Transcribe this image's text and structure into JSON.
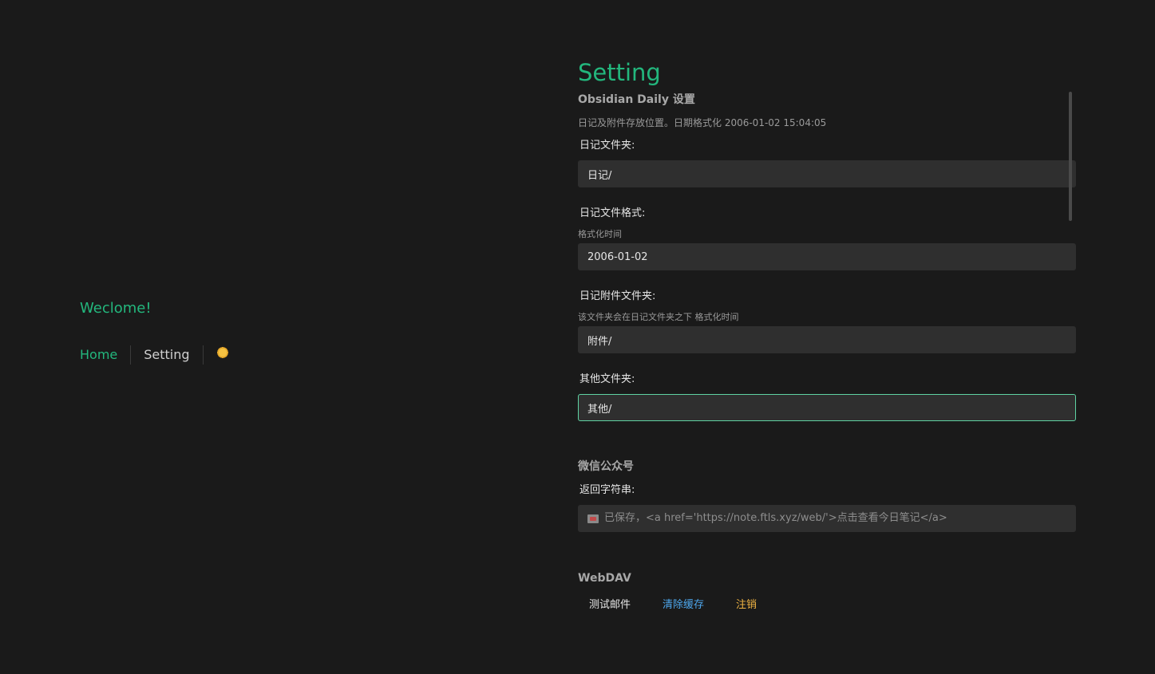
{
  "left": {
    "welcome": "Weclome!",
    "nav": {
      "home": "Home",
      "setting": "Setting",
      "theme_icon": "sun-icon"
    }
  },
  "settings": {
    "title": "Setting",
    "obsidian": {
      "title": "Obsidian Daily 设置",
      "description": "日记及附件存放位置。日期格式化 2006-01-02 15:04:05",
      "fields": {
        "diary_folder": {
          "label": "日记文件夹:",
          "value": "日记/"
        },
        "diary_format": {
          "label": "日记文件格式:",
          "hint": "格式化时间",
          "value": "2006-01-02"
        },
        "attachment_folder": {
          "label": "日记附件文件夹:",
          "hint": "该文件夹会在日记文件夹之下 格式化时间",
          "value": "附件/"
        },
        "other_folder": {
          "label": "其他文件夹:",
          "value": "其他/"
        }
      }
    },
    "wechat": {
      "title": "微信公众号",
      "return_label": "返回字符串:",
      "return_icon": "mail-icon",
      "return_value": "已保存，<a href='https://note.ftls.xyz/web/'>点击查看今日笔记</a>"
    },
    "webdav": {
      "title": "WebDAV",
      "buttons": {
        "test_mail": "测试邮件",
        "clear_cache": "清除缓存",
        "logout": "注销"
      }
    }
  },
  "colors": {
    "accent": "#23b77d",
    "background": "#1a1a1a",
    "input_bg": "#2f2f2f",
    "link_blue": "#4ea8ee",
    "warn_orange": "#f0b443"
  }
}
